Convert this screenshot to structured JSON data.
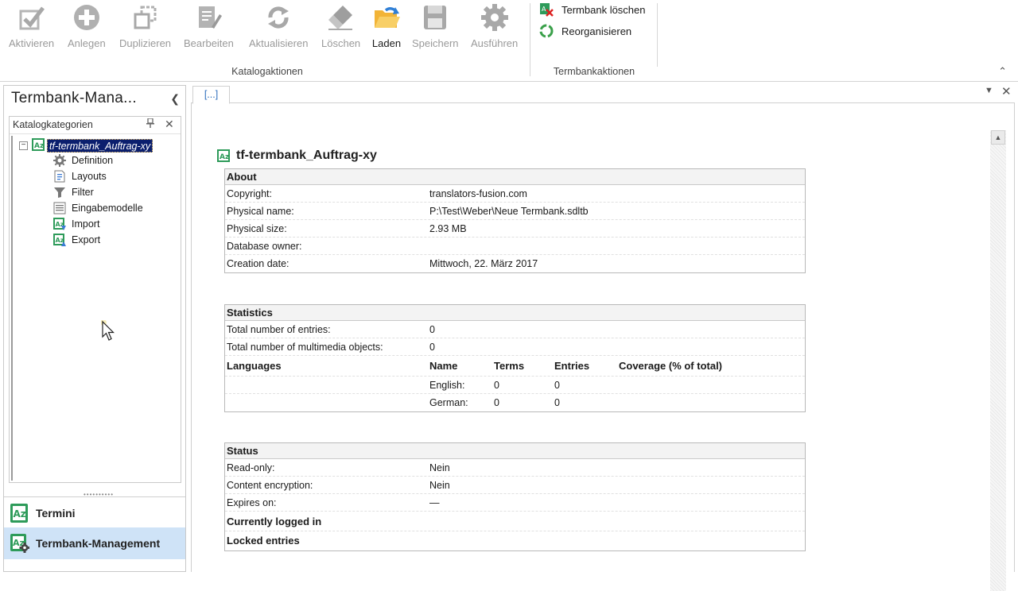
{
  "ribbon": {
    "buttons": [
      {
        "label": "Aktivieren",
        "icon": "checkmark-icon"
      },
      {
        "label": "Anlegen",
        "icon": "plus-circle-icon"
      },
      {
        "label": "Duplizieren",
        "icon": "duplicate-icon"
      },
      {
        "label": "Bearbeiten",
        "icon": "edit-document-icon"
      },
      {
        "label": "Aktualisieren",
        "icon": "refresh-icon"
      },
      {
        "label": "Löschen",
        "icon": "eraser-icon"
      },
      {
        "label": "Laden",
        "icon": "open-folder-icon"
      },
      {
        "label": "Speichern",
        "icon": "save-icon"
      },
      {
        "label": "Ausführen",
        "icon": "gear-icon"
      }
    ],
    "group_katalog": "Katalogaktionen",
    "termbank_actions": [
      {
        "label": "Termbank löschen",
        "icon": "delete-termbank-icon"
      },
      {
        "label": "Reorganisieren",
        "icon": "recycle-icon"
      }
    ],
    "group_termbank": "Termbankaktionen"
  },
  "left_panel": {
    "title": "Termbank-Mana...",
    "category_header": "Katalogkategorien",
    "tree": {
      "root": "tf-termbank_Auftrag-xy",
      "children": [
        {
          "label": "Definition",
          "icon": "gear-icon"
        },
        {
          "label": "Layouts",
          "icon": "layout-icon"
        },
        {
          "label": "Filter",
          "icon": "funnel-icon"
        },
        {
          "label": "Eingabemodelle",
          "icon": "form-icon"
        },
        {
          "label": "Import",
          "icon": "import-icon"
        },
        {
          "label": "Export",
          "icon": "export-icon"
        }
      ]
    },
    "nav": {
      "termini": "Termini",
      "management": "Termbank-Management"
    }
  },
  "document": {
    "tab_label": "[...]",
    "heading": "tf-termbank_Auftrag-xy",
    "about": {
      "title": "About",
      "rows": [
        {
          "key": "Copyright:",
          "value": "translators-fusion.com"
        },
        {
          "key": "Physical name:",
          "value": "P:\\Test\\Weber\\Neue Termbank.sdltb"
        },
        {
          "key": "Physical size:",
          "value": "2.93 MB"
        },
        {
          "key": "Database owner:",
          "value": ""
        },
        {
          "key": "Creation date:",
          "value": "Mittwoch, 22. März 2017"
        }
      ]
    },
    "statistics": {
      "title": "Statistics",
      "rows": [
        {
          "key": "Total number of entries:",
          "value": "0"
        },
        {
          "key": "Total number of multimedia objects:",
          "value": "0"
        }
      ],
      "languages_label": "Languages",
      "lang_headers": {
        "name": "Name",
        "terms": "Terms",
        "entries": "Entries",
        "coverage": "Coverage (% of total)"
      },
      "languages": [
        {
          "name": "English:",
          "terms": "0",
          "entries": "0"
        },
        {
          "name": "German:",
          "terms": "0",
          "entries": "0"
        }
      ]
    },
    "status": {
      "title": "Status",
      "rows": [
        {
          "key": "Read-only:",
          "value": "Nein"
        },
        {
          "key": "Content encryption:",
          "value": "Nein"
        },
        {
          "key": "Expires on:",
          "value": "—"
        }
      ],
      "logged_in": "Currently logged in",
      "locked": "Locked entries"
    }
  }
}
